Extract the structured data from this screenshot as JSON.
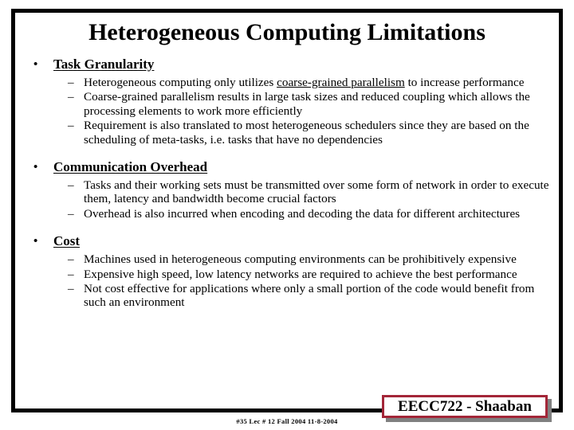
{
  "slide": {
    "title": "Heterogeneous Computing Limitations",
    "frame_color": "#000000",
    "background_color": "#ffffff"
  },
  "sections": [
    {
      "heading": "Task Granularity",
      "bullet_glyph": "•",
      "dash_glyph": "–",
      "points": [
        {
          "pre": "Heterogeneous computing only utilizes ",
          "underlined": "coarse-grained parallelism",
          "post": " to increase performance"
        },
        {
          "pre": "Coarse-grained parallelism results in large task sizes and reduced coupling which allows the processing elements to work more efficiently",
          "underlined": "",
          "post": ""
        },
        {
          "pre": "Requirement is also translated to most heterogeneous schedulers since they are based on the scheduling of meta-tasks, i.e. tasks that have no dependencies",
          "underlined": "",
          "post": ""
        }
      ]
    },
    {
      "heading": "Communication Overhead",
      "bullet_glyph": "•",
      "dash_glyph": "–",
      "points": [
        {
          "pre": "Tasks and their working sets must be transmitted over some form of network in order to execute them, latency and bandwidth become crucial factors",
          "underlined": "",
          "post": ""
        },
        {
          "pre": "Overhead is also incurred when encoding and decoding the data for different architectures",
          "underlined": "",
          "post": ""
        }
      ]
    },
    {
      "heading": "Cost",
      "bullet_glyph": "•",
      "dash_glyph": "–",
      "points": [
        {
          "pre": "Machines used in heterogeneous computing environments can be prohibitively expensive",
          "underlined": "",
          "post": ""
        },
        {
          "pre": "Expensive high speed, low latency networks are required to achieve the best performance",
          "underlined": "",
          "post": ""
        },
        {
          "pre": "Not cost effective for applications where only a small portion of the code would benefit from such an environment",
          "underlined": "",
          "post": ""
        }
      ]
    }
  ],
  "badge": {
    "text": "EECC722 - Shaaban",
    "border_color": "#a32638",
    "shadow_color": "#808080",
    "fill_color": "#ffffff"
  },
  "footnote": {
    "text": "#35   Lec # 12    Fall 2004  11-8-2004"
  }
}
